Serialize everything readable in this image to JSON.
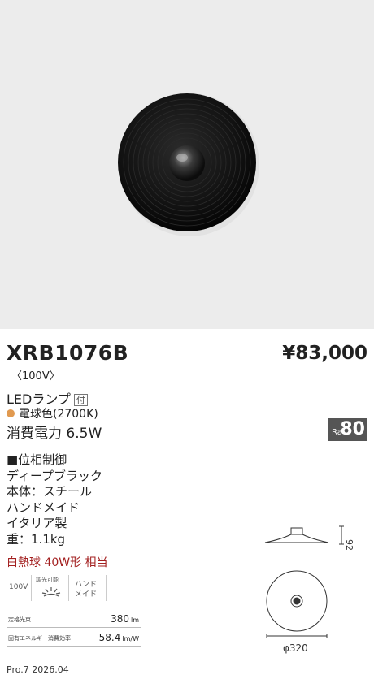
{
  "product": {
    "model": "XRB1076B",
    "price": "¥83,000",
    "voltage": "〈100V〉",
    "lamp_label": "LEDランプ",
    "lamp_badge": "付",
    "color_temp": "電球色(2700K)",
    "power": "消費電力 6.5W",
    "ra_label": "Ra",
    "ra_value": "80"
  },
  "specs": [
    "■位相制御",
    "ディープブラック",
    "本体：スチール",
    "ハンドメイド",
    "イタリア製",
    "重：1.1kg"
  ],
  "equivalent": "白熱球 40W形 相当",
  "icons": {
    "voltage": "100V",
    "dimming": "調光可能",
    "handmade_line1": "ハンド",
    "handmade_line2": "メイド"
  },
  "performance": {
    "flux_label": "定格光束",
    "flux_value": "380",
    "flux_unit": "lm",
    "efficiency_label": "固有エネルギー消費効率",
    "efficiency_value": "58.4",
    "efficiency_unit": "lm/W"
  },
  "dimensions": {
    "height": "92",
    "diameter": "φ320"
  },
  "footer": "Pro.7 2026.04",
  "colors": {
    "photo_bg": "#ececec",
    "lamp_dot": "#e19a50",
    "equivalent_text": "#a32020",
    "ra_badge": "#555555"
  }
}
